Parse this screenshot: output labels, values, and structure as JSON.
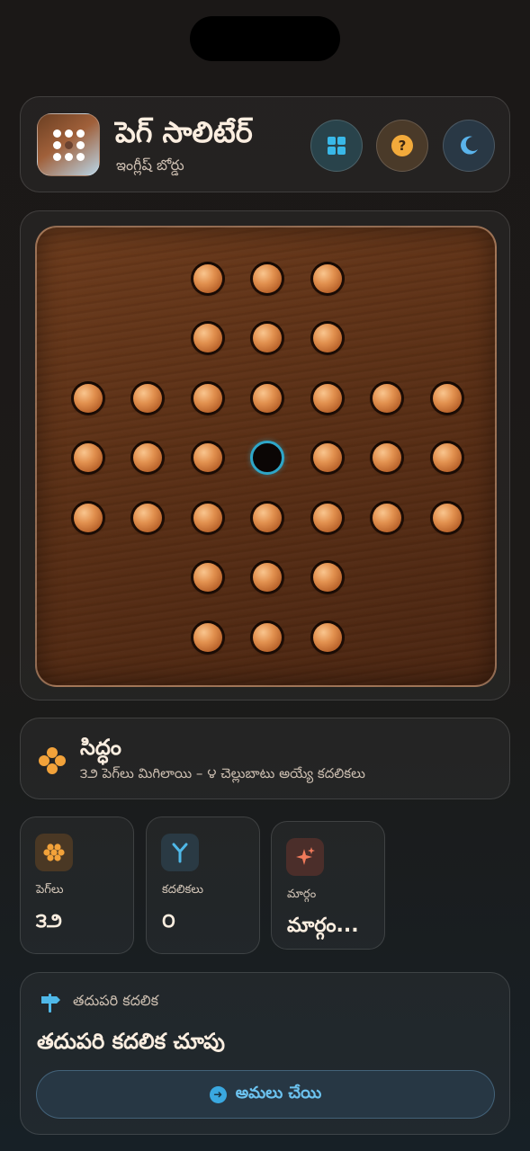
{
  "header": {
    "title": "పెగ్ సాలిటేర్",
    "subtitle": "ఇంగ్లీష్ బోర్డు",
    "icons": [
      "grid-icon",
      "help-icon",
      "moon-icon"
    ],
    "help_glyph": "?"
  },
  "board": {
    "layout": "english",
    "empty_hole": "center",
    "peg_color": "#e2914f",
    "empty_hole_color": "#2ea6c8"
  },
  "status": {
    "title": "సిద్ధం",
    "subtitle": "౩౨ పెగ్‌లు మిగిలాయి – ౪ చెల్లుబాటు అయ్యే కదలికలు"
  },
  "stats": [
    {
      "label": "పెగ్‌లు",
      "value": "౩౨",
      "icon": "pegs-icon"
    },
    {
      "label": "కదలికలు",
      "value": "౦",
      "icon": "moves-icon"
    },
    {
      "label": "మార్గం",
      "value": "మార్గం...",
      "icon": "sparkle-icon"
    }
  ],
  "hint": {
    "label": "తదుపరి కదలిక",
    "title": "తదుపరి కదలిక చూపు",
    "button_label": "అమలు చేయి"
  },
  "colors": {
    "accent_orange": "#f2a23a",
    "accent_blue": "#3aa8e0",
    "background": "#1b1817"
  }
}
